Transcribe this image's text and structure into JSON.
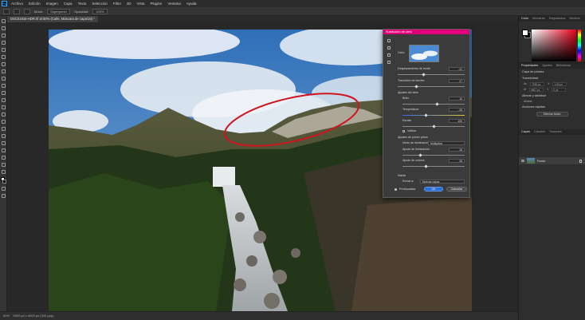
{
  "app": {
    "logo": "Ps",
    "accent": "#31a8ff",
    "dialog_accent": "#e2007a"
  },
  "menu": [
    "Archivo",
    "Edición",
    "Imagen",
    "Capa",
    "Texto",
    "Selección",
    "Filtro",
    "3D",
    "Vista",
    "Plugins",
    "Ventana",
    "Ayuda"
  ],
  "options": {
    "mode_label": "Modo:",
    "mode_value": "Superponer",
    "opacity_label": "Opacidad:",
    "opacity_value": "100%"
  },
  "document_tab": "DSC01916-HDR.tif al 50% (Calle, Máscara de capa/16) *",
  "status": {
    "zoom": "50%",
    "doc": "6000 px x 4000 px (300 ppp)"
  },
  "right_panel": {
    "color_tabs": [
      "Color",
      "Muestras",
      "Degradados",
      "Motivos"
    ],
    "props_tabs": [
      "Propiedades",
      "Ajustes",
      "Bibliotecas"
    ],
    "layer_label": "Capa de píxeles",
    "transform_title": "Transformar",
    "w_label": "An",
    "w_value": "7952 px",
    "h_label": "Al",
    "h_value": "4867 px",
    "x_label": "X",
    "x_value": "1,69 px",
    "y_label": "Y",
    "y_value": "0 px",
    "align_title": "Alinear y distribuir",
    "align_sub": "Alinear:",
    "quick_title": "Acciones rápidas",
    "quick_button": "Eliminar fondo",
    "layers_tabs": [
      "Capas",
      "Canales",
      "Trazados"
    ],
    "layer_name": "Fondo"
  },
  "dialog": {
    "title": "Sustitución de cielo",
    "cielo_label": "Cielo:",
    "shift_edge_label": "Desplazamiento de borde",
    "shift_edge_value": "-31",
    "fade_edge_label": "Transición de bordes",
    "fade_edge_value": "27",
    "sky_adjust_label": "Ajustes del cielo",
    "brightness_label": "Brillo",
    "brightness_value": "10",
    "temperature_label": "Temperatura",
    "temperature_value": "-26",
    "scale_label": "Escala",
    "scale_value": "100",
    "flip_label": "Voltear",
    "foreground_label": "Ajustes de primer plano",
    "lighting_mode_label": "Modo de iluminación",
    "lighting_mode_value": "Multiplicar",
    "lighting_adjust_label": "Ajuste de iluminación",
    "lighting_adjust_value": "28",
    "color_adjust_label": "Ajuste de colores",
    "color_adjust_value": "38",
    "output_label": "Salida",
    "output_to_label": "Enviar a:",
    "output_to_value": "Nuevas capas",
    "preview_label": "Previsualizar",
    "ok_label": "OK",
    "cancel_label": "Cancelar"
  }
}
